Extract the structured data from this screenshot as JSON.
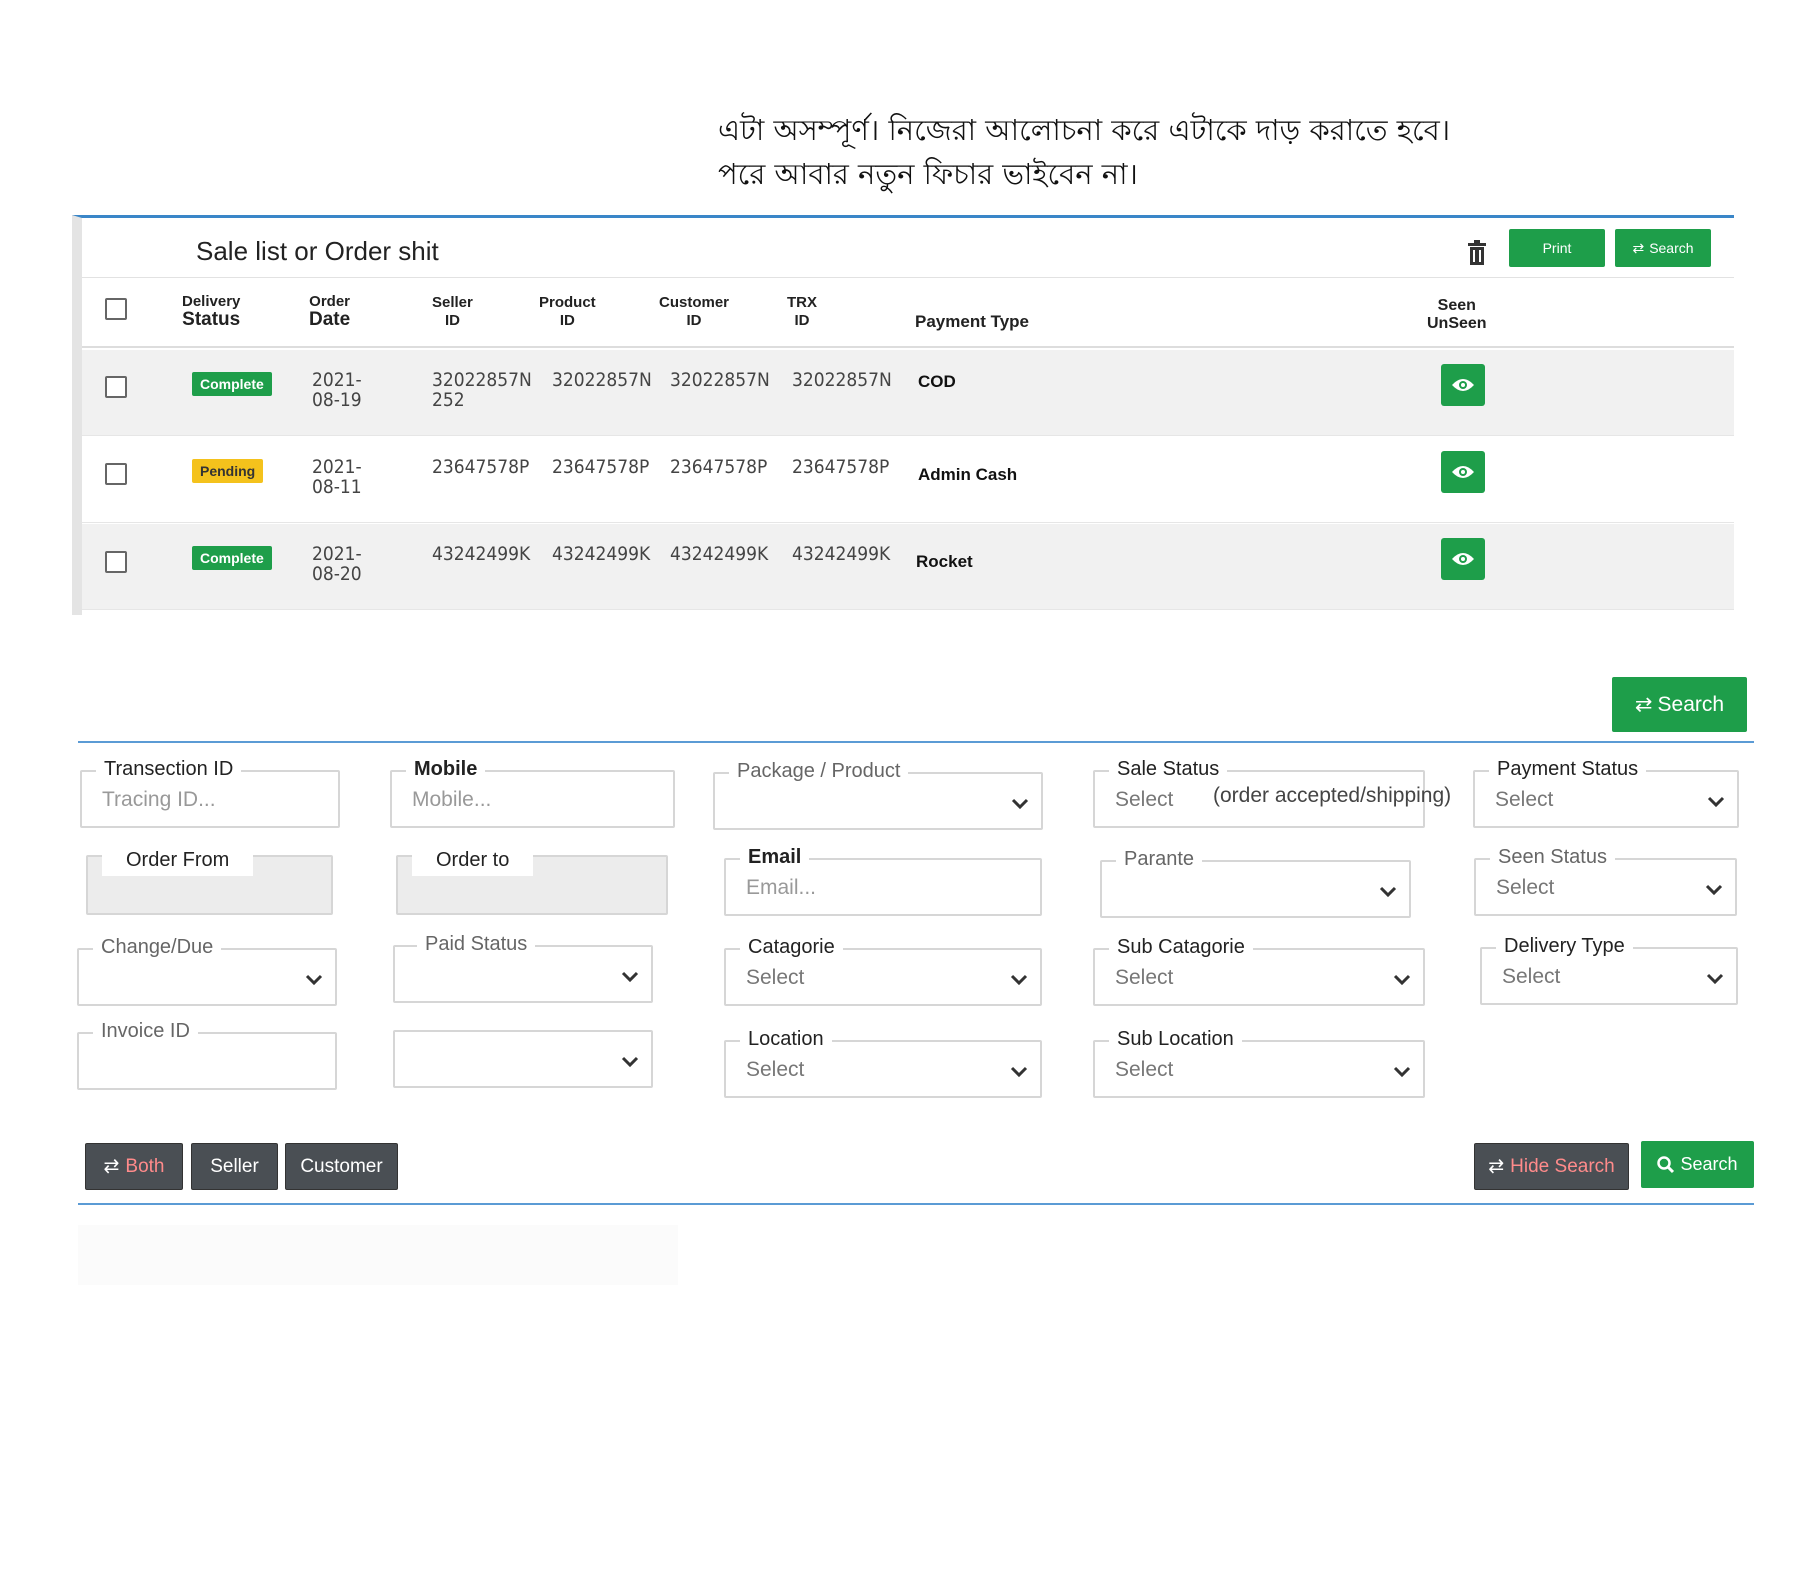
{
  "note": {
    "line1": "এটা অসম্পূর্ণ। নিজেরা আলোচনা করে এটাকে দাড় করাতে হবে।",
    "line2": "পরে আবার নতুন ফিচার ভাইবেন না।"
  },
  "panel": {
    "title": "Sale list or Order shit",
    "print_label": "Print",
    "search_label": "Search"
  },
  "table": {
    "headers": {
      "delivery_status": [
        "Delivery",
        "Status"
      ],
      "order_date": [
        "Order",
        "Date"
      ],
      "seller_id": [
        "Seller",
        "ID"
      ],
      "product_id": [
        "Product",
        "ID"
      ],
      "customer_id": [
        "Customer",
        "ID"
      ],
      "trx_id": [
        "TRX",
        "ID"
      ],
      "payment_type": "Payment Type",
      "seen": [
        "Seen",
        "UnSeen"
      ]
    },
    "rows": [
      {
        "status": "Complete",
        "date1": "2021-",
        "date2": "08-19",
        "seller1": "32022857N",
        "seller2": "252",
        "product": "32022857N",
        "customer": "32022857N",
        "trx": "32022857N",
        "payment": "COD"
      },
      {
        "status": "Pending",
        "date1": "2021-",
        "date2": "08-11",
        "seller1": "23647578P",
        "seller2": "",
        "product": "23647578P",
        "customer": "23647578P",
        "trx": "23647578P",
        "payment": "Admin Cash"
      },
      {
        "status": "Complete",
        "date1": "2021-",
        "date2": "08-20",
        "seller1": "43242499K",
        "seller2": "",
        "product": "43242499K",
        "customer": "43242499K",
        "trx": "43242499K",
        "payment": "Rocket"
      }
    ]
  },
  "search": {
    "top_button": "Search",
    "transaction_id": {
      "label": "Transection ID",
      "placeholder": "Tracing ID..."
    },
    "mobile": {
      "label": "Mobile",
      "placeholder": "Mobile..."
    },
    "package": {
      "label": "Package / Product"
    },
    "sale_status": {
      "label": "Sale Status",
      "value": "Select",
      "note": "(order accepted/shipping)"
    },
    "payment_status": {
      "label": "Payment Status",
      "value": "Select"
    },
    "order_from": {
      "label": "Order From"
    },
    "order_to": {
      "label": "Order to"
    },
    "email": {
      "label": "Email",
      "placeholder": "Email..."
    },
    "parante": {
      "label": "Parante"
    },
    "seen_status": {
      "label": "Seen Status",
      "value": "Select"
    },
    "change_due": {
      "label": "Change/Due"
    },
    "paid_status": {
      "label": "Paid Status"
    },
    "catagorie": {
      "label": "Catagorie",
      "value": "Select"
    },
    "sub_catagorie": {
      "label": "Sub Catagorie",
      "value": "Select"
    },
    "delivery_type": {
      "label": "Delivery Type",
      "value": "Select"
    },
    "invoice_id": {
      "label": "Invoice ID"
    },
    "location": {
      "label": "Location",
      "value": "Select"
    },
    "sub_location": {
      "label": "Sub Location",
      "value": "Select"
    },
    "both_label": "Both",
    "seller_label": "Seller",
    "customer_label": "Customer",
    "hide_search_label": "Hide Search",
    "bottom_search_label": "Search"
  },
  "colors": {
    "accent_green": "#1e9e4a",
    "pending_yellow": "#f4c21c",
    "divider_blue": "#5b9bd5"
  }
}
